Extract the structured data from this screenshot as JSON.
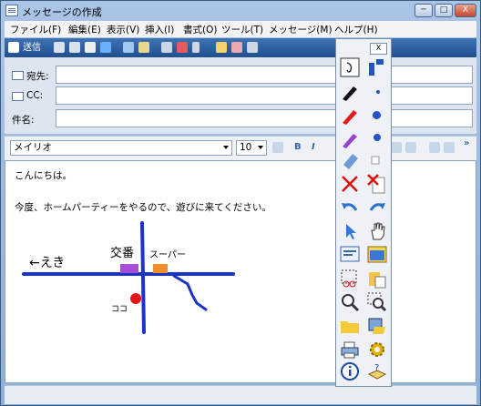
{
  "window": {
    "title": "メッセージの作成",
    "controls": {
      "minimize": "─",
      "maximize": "□",
      "close": "X"
    }
  },
  "menu": [
    "ファイル(F)",
    "編集(E)",
    "表示(V)",
    "挿入(I)",
    "書式(O)",
    "ツール(T)",
    "メッセージ(M)",
    "ヘルプ(H)"
  ],
  "toolbar": {
    "send_label": "送信"
  },
  "header": {
    "to_label": "宛先:",
    "cc_label": "CC:",
    "subject_label": "件名:",
    "to_value": "",
    "cc_value": "",
    "subject_value": ""
  },
  "format": {
    "font": "メイリオ",
    "size": "10",
    "bold": "B",
    "italic": "I",
    "underline": "U",
    "more": "»"
  },
  "body": {
    "line1": "こんにちは。",
    "line2": "今度、ホームパーティーをやるので、遊びに来てください。",
    "map": {
      "left_label": "←えき",
      "koban_label": "交番",
      "super_label": "スーパー",
      "here_label": "ココ"
    },
    "colors": {
      "roads": "#1a33c8",
      "koban": "#a64fd6",
      "super": "#f0902a",
      "here": "#e8141c"
    }
  },
  "palette": {
    "close": "X",
    "tools": [
      "pointer-tool-icon",
      "color-palette-icon",
      "marker-black-icon",
      "small-dot-icon",
      "marker-red-icon",
      "medium-dot-icon",
      "marker-purple-icon",
      "large-dot-icon",
      "eraser-icon",
      "square-icon",
      "delete-icon",
      "delete-page-icon",
      "undo-icon",
      "redo-icon",
      "select-arrow-icon",
      "hand-icon",
      "insert-picture-icon",
      "window-icon",
      "cut-select-icon",
      "paste-icon",
      "zoom-icon",
      "zoom-region-icon",
      "folder-icon",
      "save-icon",
      "print-icon",
      "settings-icon",
      "info-icon",
      "help-book-icon"
    ]
  }
}
